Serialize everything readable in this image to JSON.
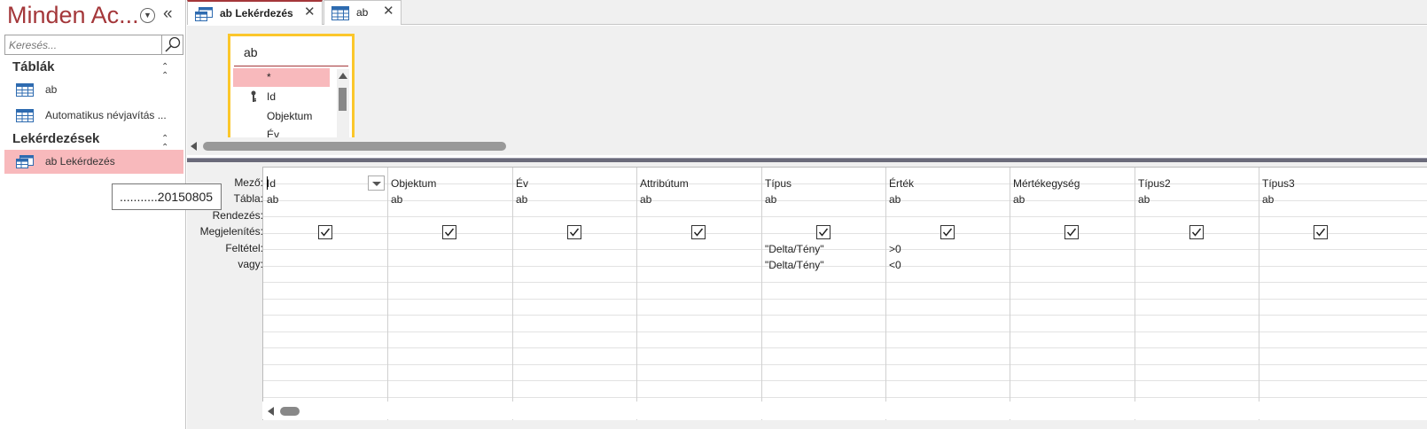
{
  "nav": {
    "title": "Minden Ac...",
    "search_placeholder": "Keresés...",
    "groups": [
      {
        "label": "Táblák",
        "items": [
          "ab",
          "Automatikus névjavítás ..."
        ]
      },
      {
        "label": "Lekérdezések",
        "items": [
          "ab Lekérdezés"
        ]
      }
    ],
    "tooltip": "...........20150805"
  },
  "tabs": [
    {
      "label": "ab Lekérdezés",
      "active": true,
      "icon": "query-icon"
    },
    {
      "label": "ab",
      "active": false,
      "icon": "table-icon"
    }
  ],
  "table_box": {
    "title": "ab",
    "fields": [
      "*",
      "Id",
      "Objektum",
      "Év"
    ]
  },
  "grid": {
    "row_labels": [
      "Mező:",
      "Tábla:",
      "Rendezés:",
      "Megjelenítés:",
      "Feltétel:",
      "vagy:"
    ],
    "columns": [
      {
        "field": "Id",
        "table": "ab",
        "show": true,
        "criteria": "",
        "or": ""
      },
      {
        "field": "Objektum",
        "table": "ab",
        "show": true,
        "criteria": "",
        "or": ""
      },
      {
        "field": "Év",
        "table": "ab",
        "show": true,
        "criteria": "",
        "or": ""
      },
      {
        "field": "Attribútum",
        "table": "ab",
        "show": true,
        "criteria": "",
        "or": ""
      },
      {
        "field": "Típus",
        "table": "ab",
        "show": true,
        "criteria": "\"Delta/Tény\"",
        "or": "\"Delta/Tény\""
      },
      {
        "field": "Érték",
        "table": "ab",
        "show": true,
        "criteria": ">0",
        "or": "<0"
      },
      {
        "field": "Mértékegység",
        "table": "ab",
        "show": true,
        "criteria": "",
        "or": ""
      },
      {
        "field": "Típus2",
        "table": "ab",
        "show": true,
        "criteria": "",
        "or": ""
      },
      {
        "field": "Típus3",
        "table": "ab",
        "show": true,
        "criteria": "",
        "or": ""
      }
    ]
  },
  "colors": {
    "accent": "#a4373a",
    "selection": "#f8b9bc",
    "table_border": "#fbc72b"
  }
}
